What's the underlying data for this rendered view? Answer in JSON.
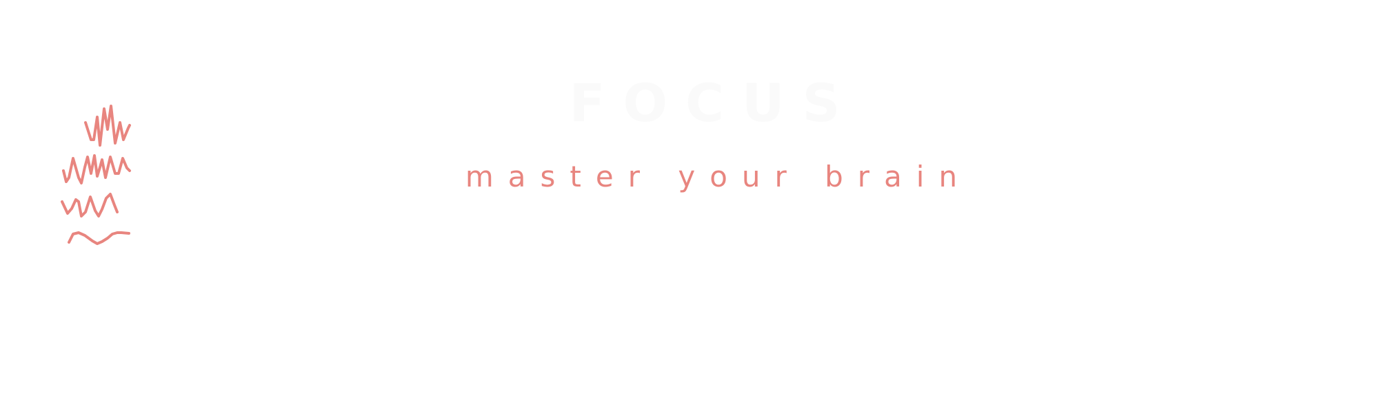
{
  "brand": {
    "title": "FOCUS",
    "tagline": "master your brain",
    "logo_icon": "brainwave-icon"
  },
  "colors": {
    "accent": "#e8857f",
    "title": "#fafafa",
    "background": "#ffffff"
  }
}
